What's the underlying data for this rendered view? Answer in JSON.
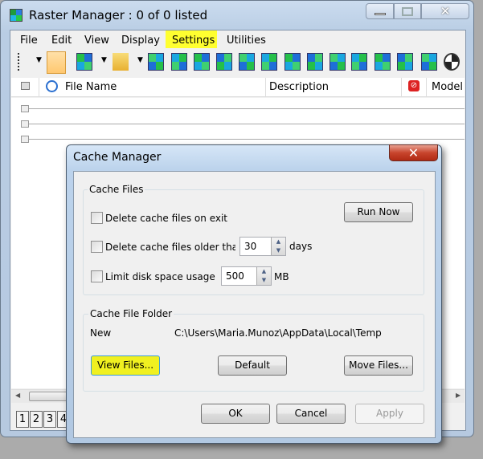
{
  "main_window": {
    "title": "Raster Manager : 0 of 0 listed",
    "menu": [
      "File",
      "Edit",
      "View",
      "Display",
      "Settings",
      "Utilities"
    ],
    "highlighted_menu": "Settings",
    "toolbar_icons": [
      "tree-view-icon",
      "list-sort-icon",
      "raster-attach-icon",
      "folder-open-icon",
      "reload-icon",
      "select-icon",
      "raster-icon",
      "raster-scale-icon",
      "raster-detach-icon",
      "transform-icon",
      "move-icon",
      "clip-icon",
      "rotate-icon",
      "mirror-icon",
      "warp-icon",
      "terrain-icon",
      "zoom-1-1-icon",
      "display-globe-icon"
    ],
    "columns": [
      "File Name",
      "Description",
      "Model"
    ],
    "page_tabs": [
      "1",
      "2",
      "3",
      "4"
    ]
  },
  "dialog": {
    "title": "Cache Manager",
    "cache_files": {
      "label": "Cache Files",
      "delete_on_exit": {
        "label": "Delete cache files on exit",
        "checked": false
      },
      "delete_older": {
        "label": "Delete cache files older than",
        "checked": false,
        "value": "30",
        "unit": "days"
      },
      "limit_disk": {
        "label": "Limit disk space usage to",
        "checked": false,
        "value": "500",
        "unit": "MB"
      },
      "run_now": "Run Now"
    },
    "folder": {
      "label": "Cache File Folder",
      "name": "New",
      "path": "C:\\Users\\Maria.Munoz\\AppData\\Local\\Temp",
      "view_files": "View Files...",
      "default": "Default",
      "move_files": "Move Files..."
    },
    "ok": "OK",
    "cancel": "Cancel",
    "apply": "Apply",
    "highlight_color": "#ffff30"
  }
}
